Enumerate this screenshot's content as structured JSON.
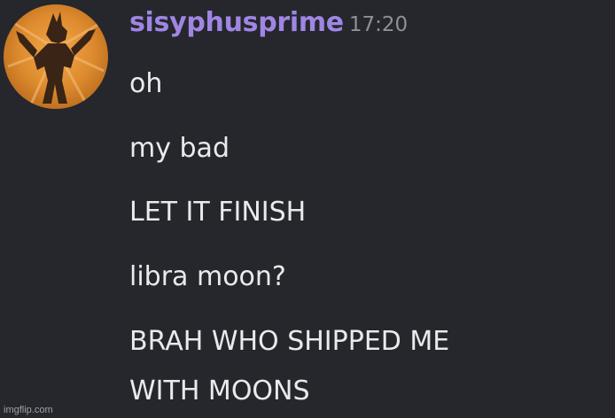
{
  "message": {
    "username": "sisyphusprime",
    "timestamp": "17:20",
    "lines": [
      "oh",
      "my bad",
      "LET IT FINISH",
      "libra moon?",
      "BRAH WHO SHIPPED ME",
      "WITH MOONS"
    ]
  },
  "avatar": {
    "icon": "armored-figure-avatar-icon",
    "colors": {
      "background": "#dd8a2e",
      "figure": "#3a2416"
    }
  },
  "watermark": "imgflip.com",
  "colors": {
    "background": "#25272c",
    "username": "#9f86e4",
    "timestamp": "#8d9097",
    "text": "#e9eaec"
  }
}
